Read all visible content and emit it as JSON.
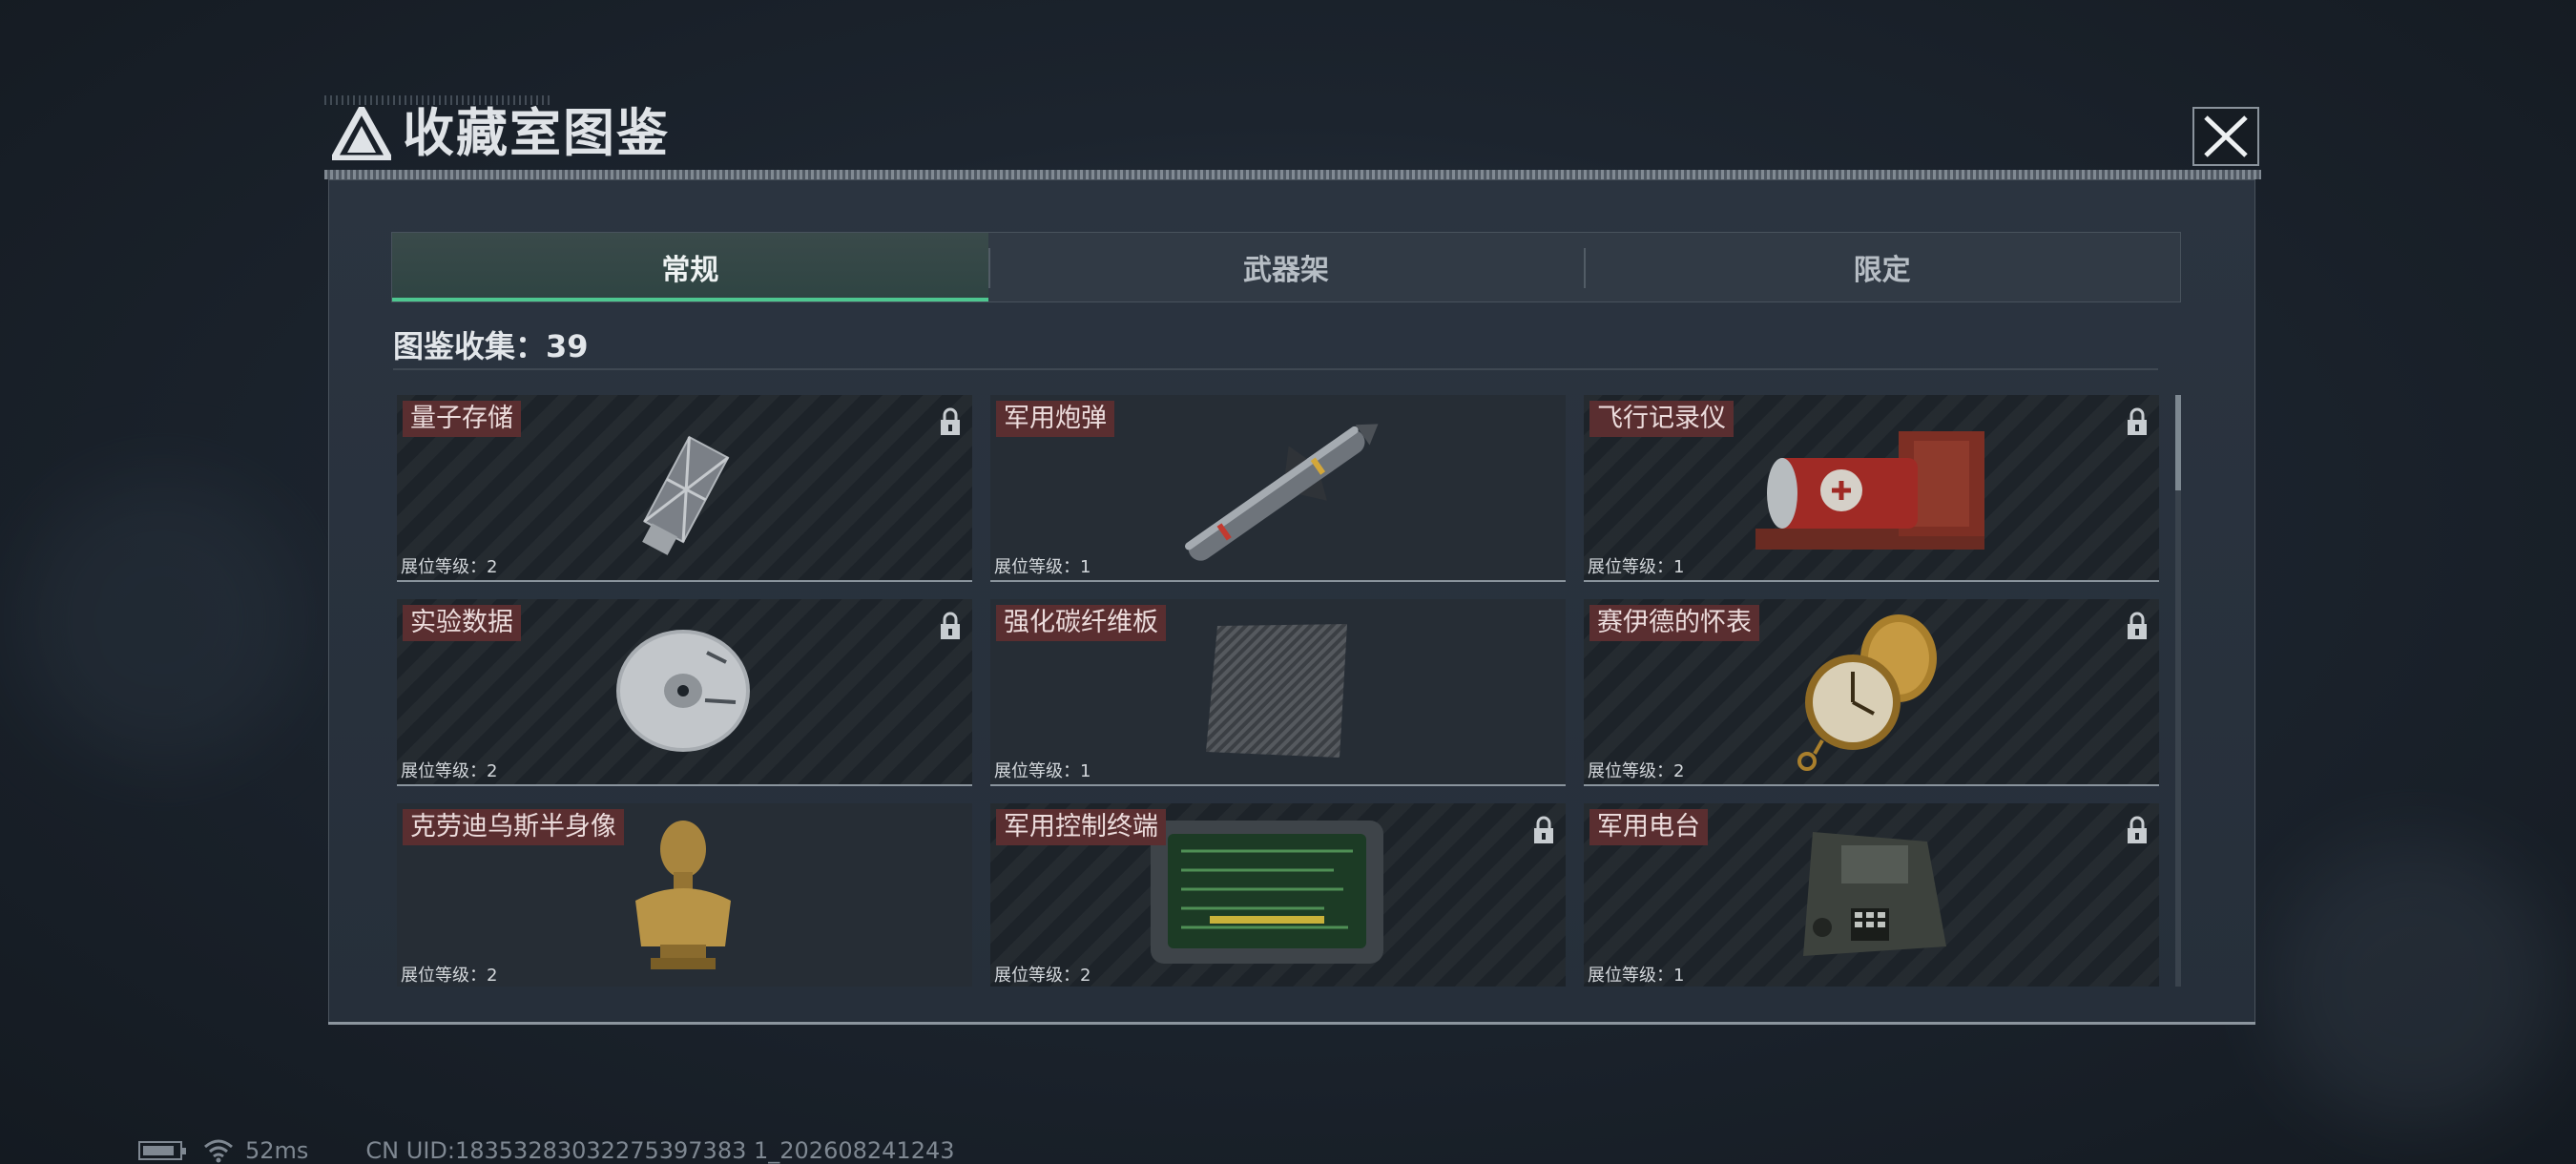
{
  "window": {
    "title": "收藏室图鉴"
  },
  "tabs": [
    {
      "label": "常规",
      "active": true
    },
    {
      "label": "武器架",
      "active": false
    },
    {
      "label": "限定",
      "active": false
    }
  ],
  "collection": {
    "label": "图鉴收集：39"
  },
  "level_label": "展位等级：",
  "items": [
    {
      "name": "量子存储",
      "level": "2",
      "locked": true,
      "icon": "usb-drive-icon"
    },
    {
      "name": "军用炮弹",
      "level": "1",
      "locked": false,
      "icon": "missile-icon"
    },
    {
      "name": "飞行记录仪",
      "level": "1",
      "locked": true,
      "icon": "flight-recorder-icon"
    },
    {
      "name": "实验数据",
      "level": "2",
      "locked": true,
      "icon": "disc-icon"
    },
    {
      "name": "强化碳纤维板",
      "level": "1",
      "locked": false,
      "icon": "carbon-plate-icon"
    },
    {
      "name": "赛伊德的怀表",
      "level": "2",
      "locked": true,
      "icon": "pocket-watch-icon"
    },
    {
      "name": "克劳迪乌斯半身像",
      "level": "2",
      "locked": false,
      "icon": "bust-icon"
    },
    {
      "name": "军用控制终端",
      "level": "2",
      "locked": true,
      "icon": "control-terminal-icon"
    },
    {
      "name": "军用电台",
      "level": "1",
      "locked": true,
      "icon": "radio-icon"
    }
  ],
  "status": {
    "ping": "52ms",
    "uid": "CN UID:18353283032275397383 1_202608241243"
  },
  "colors": {
    "accent": "#4ec790",
    "name_tag": "#5a2e30"
  }
}
